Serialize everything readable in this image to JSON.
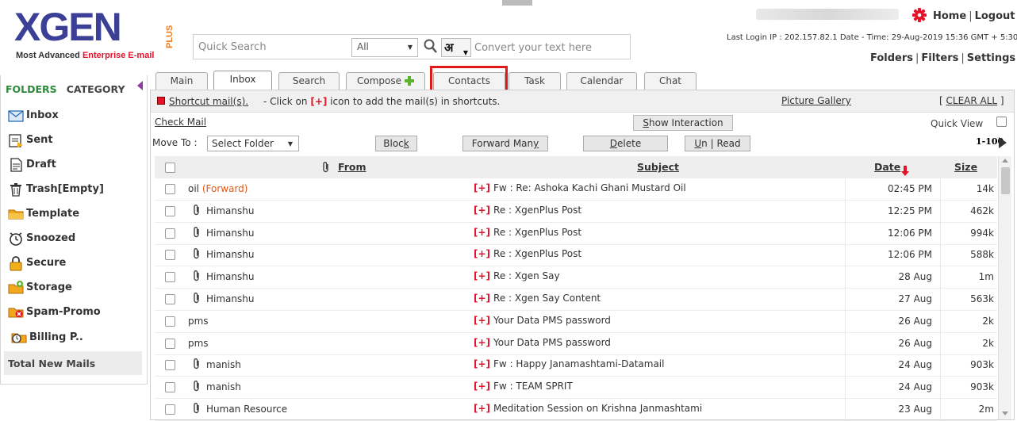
{
  "brand": {
    "logo_text": "XGEN",
    "logo_plus": "PLUS",
    "tagline_pre": "Most Advanced ",
    "tagline_accent": "Enterprise E-mail"
  },
  "search": {
    "placeholder": "Quick Search",
    "scope": "All",
    "lang_label": "अ",
    "convert_placeholder": "Convert your text here"
  },
  "topbar": {
    "home_label": "Home",
    "logout_label": "Logout",
    "login_info": "Last Login IP : 202.157.82.1 Date - Time: 29-Aug-2019 15:36 GMT + 5:30",
    "folders_label": "Folders",
    "filters_label": "Filters",
    "settings_label": "Settings"
  },
  "sidebar": {
    "folders_label": "FOLDERS",
    "category_label": "CATEGORY",
    "items": [
      {
        "label": "Inbox",
        "icon": "inbox-icon"
      },
      {
        "label": "Sent",
        "icon": "sent-icon"
      },
      {
        "label": "Draft",
        "icon": "draft-icon"
      },
      {
        "label": "Trash[Empty]",
        "icon": "trash-icon"
      },
      {
        "label": "Template",
        "icon": "template-icon"
      },
      {
        "label": "Snoozed",
        "icon": "snooze-icon"
      },
      {
        "label": "Secure",
        "icon": "lock-icon"
      },
      {
        "label": "Storage",
        "icon": "storage-icon"
      },
      {
        "label": "Spam-Promo",
        "icon": "spam-icon"
      },
      {
        "label": "Billing P..",
        "icon": "billing-icon"
      }
    ],
    "total_label": "Total New Mails"
  },
  "tabs": [
    {
      "label": "Main"
    },
    {
      "label": "Inbox"
    },
    {
      "label": "Search"
    },
    {
      "label": "Compose"
    },
    {
      "label": "Contacts"
    },
    {
      "label": "Task"
    },
    {
      "label": "Calendar"
    },
    {
      "label": "Chat"
    }
  ],
  "active_tab": "Inbox",
  "highlighted_tab": "Contacts",
  "shortcut": {
    "link": "Shortcut mail(s).",
    "text_pre": " - Click on ",
    "plus": "[+]",
    "text_post": " icon to add the mail(s) in shortcuts.",
    "gallery": "Picture Gallery",
    "clear_open": "[ ",
    "clear": "CLEAR ALL",
    "clear_close": " ]"
  },
  "toolbar": {
    "check_mail": "Check Mail",
    "show_interaction_key": "S",
    "show_interaction_rest": "how Interaction",
    "quick_view": "Quick View",
    "move_to": "Move To :",
    "select_folder": "Select Folder",
    "block_pre": "Bloc",
    "block_key": "k",
    "forward_pre": "Forward Man",
    "forward_key": "y",
    "delete_key": "D",
    "delete_rest": "elete",
    "unread_key": "U",
    "unread_rest": "n | Read",
    "pager": "1-100"
  },
  "table": {
    "headers": {
      "from": "From",
      "subject": "Subject",
      "date": "Date",
      "size": "Size"
    },
    "rows": [
      {
        "from": "oil",
        "tag": "(Forward)",
        "attachment": false,
        "subject": "Fw : Re: Ashoka Kachi Ghani Mustard Oil",
        "date": "02:45 PM",
        "size": "14k"
      },
      {
        "from": "Himanshu",
        "tag": "",
        "attachment": true,
        "subject": "Re : XgenPlus Post",
        "date": "12:25 PM",
        "size": "462k"
      },
      {
        "from": "Himanshu",
        "tag": "",
        "attachment": true,
        "subject": "Re : XgenPlus Post",
        "date": "12:06 PM",
        "size": "994k"
      },
      {
        "from": "Himanshu",
        "tag": "",
        "attachment": true,
        "subject": "Re : XgenPlus Post",
        "date": "12:06 PM",
        "size": "588k"
      },
      {
        "from": "Himanshu",
        "tag": "",
        "attachment": true,
        "subject": "Re : Xgen Say",
        "date": "28 Aug",
        "size": "1m"
      },
      {
        "from": "Himanshu",
        "tag": "",
        "attachment": true,
        "subject": "Re : Xgen Say Content",
        "date": "27 Aug",
        "size": "563k"
      },
      {
        "from": "pms",
        "tag": "",
        "attachment": false,
        "subject": "Your Data PMS password",
        "date": "26 Aug",
        "size": "2k"
      },
      {
        "from": "pms",
        "tag": "",
        "attachment": false,
        "subject": "Your Data PMS password",
        "date": "26 Aug",
        "size": "2k"
      },
      {
        "from": "manish",
        "tag": "",
        "attachment": true,
        "subject": "Fw : Happy Janamashtami-Datamail",
        "date": "24 Aug",
        "size": "903k"
      },
      {
        "from": "manish",
        "tag": "",
        "attachment": true,
        "subject": "Fw : TEAM SPRIT",
        "date": "24 Aug",
        "size": "903k"
      },
      {
        "from": "Human Resource",
        "tag": "",
        "attachment": true,
        "subject": "Meditation Session on Krishna Janmashtami",
        "date": "23 Aug",
        "size": "2m"
      }
    ],
    "plus_marker": "[+]"
  },
  "colors": {
    "brand_blue": "#3b3f95",
    "brand_orange": "#f07a1a",
    "accent_red": "#e3142a",
    "folders_green": "#2d8a3a",
    "highlight_red": "#e11919"
  }
}
